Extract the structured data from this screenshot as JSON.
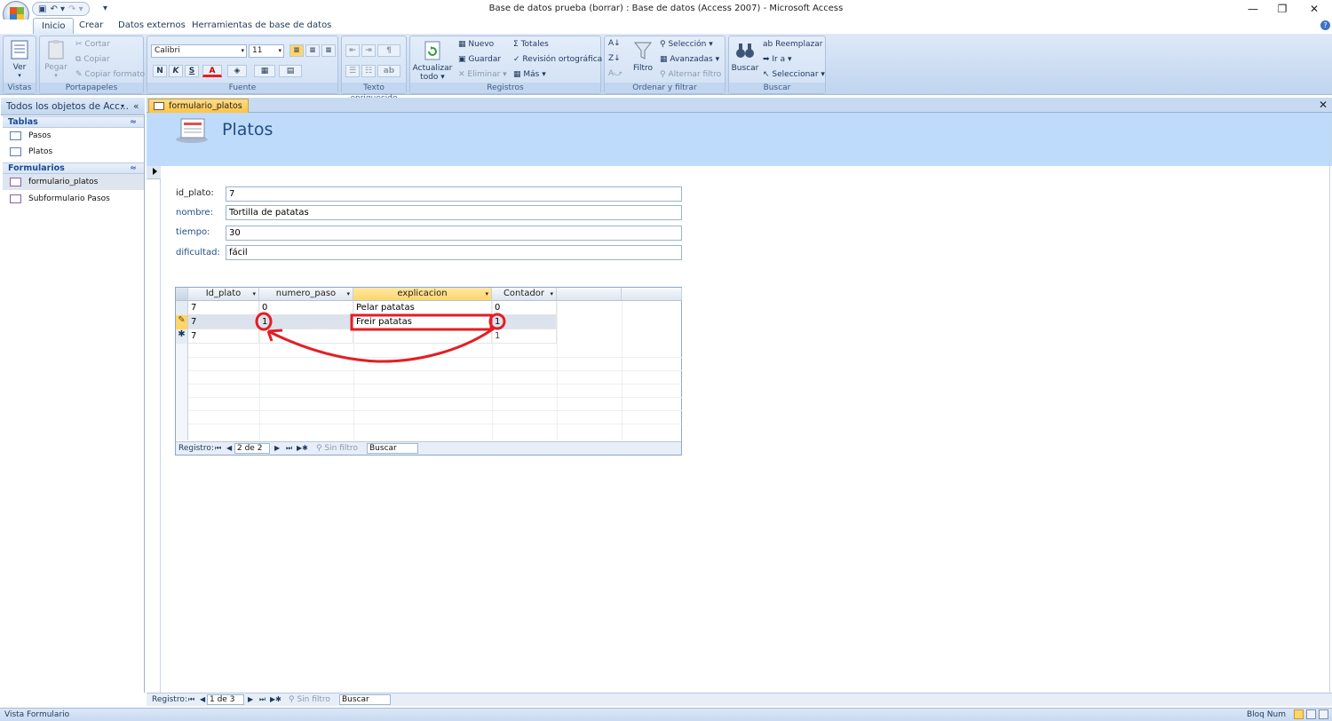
{
  "window": {
    "title": "Base de datos prueba (borrar) : Base de datos (Access 2007) - Microsoft Access",
    "controls": [
      "—",
      "❐",
      "✕"
    ]
  },
  "ribbon": {
    "tabs": [
      "Inicio",
      "Crear",
      "Datos externos",
      "Herramientas de base de datos"
    ],
    "active_tab": "Inicio",
    "groups": {
      "vistas": {
        "label": "Vistas",
        "ver": "Ver"
      },
      "portapapeles": {
        "label": "Portapapeles",
        "pegar": "Pegar",
        "cortar": "Cortar",
        "copiar": "Copiar",
        "copiar_formato": "Copiar formato"
      },
      "fuente": {
        "label": "Fuente",
        "font": "Calibri",
        "size": "11",
        "bold": "N",
        "italic": "K",
        "underline": "S"
      },
      "texto": {
        "label": "Texto enriquecido"
      },
      "registros": {
        "label": "Registros",
        "actualizar": "Actualizar",
        "todo": "todo",
        "nuevo": "Nuevo",
        "guardar": "Guardar",
        "eliminar": "Eliminar",
        "totales": "Totales",
        "revision": "Revisión ortográfica",
        "mas": "Más"
      },
      "ordenar": {
        "label": "Ordenar y filtrar",
        "filtro": "Filtro",
        "seleccion": "Selección",
        "avanzadas": "Avanzadas",
        "alternar": "Alternar filtro"
      },
      "buscar": {
        "label": "Buscar",
        "buscar": "Buscar",
        "reemplazar": "Reemplazar",
        "ira": "Ir a",
        "seleccionar": "Seleccionar"
      }
    }
  },
  "nav": {
    "header": "Todos los objetos de Acc...",
    "sections": [
      {
        "title": "Tablas",
        "items": [
          "Pasos",
          "Platos"
        ]
      },
      {
        "title": "Formularios",
        "items": [
          "formulario_platos",
          "Subformulario Pasos"
        ]
      }
    ]
  },
  "doc_tab": "formulario_platos",
  "form": {
    "title": "Platos",
    "fields": [
      {
        "label": "id_plato:",
        "value": "7"
      },
      {
        "label": "nombre:",
        "value": "Tortilla de patatas"
      },
      {
        "label": "tiempo:",
        "value": "30"
      },
      {
        "label": "dificultad:",
        "value": "fácil"
      }
    ]
  },
  "subform": {
    "columns": [
      "Id_plato",
      "numero_paso",
      "explicacion",
      "Contador"
    ],
    "rows": [
      {
        "selector": "",
        "cells": [
          "7",
          "0",
          "Pelar patatas",
          "0"
        ]
      },
      {
        "selector": "✎",
        "cells": [
          "7",
          "1",
          "Freir patatas",
          "1"
        ]
      },
      {
        "selector": "✱",
        "cells": [
          "7",
          "",
          "",
          "1"
        ]
      }
    ],
    "record_nav": {
      "label": "Registro:",
      "position": "2 de 2",
      "filter": "Sin filtro",
      "search": "Buscar"
    }
  },
  "main_record_nav": {
    "label": "Registro:",
    "position": "1 de 3",
    "filter": "Sin filtro",
    "search": "Buscar"
  },
  "status": {
    "left": "Vista Formulario",
    "right": "Bloq Num"
  },
  "colors": {
    "ribbon": "#c8daf2",
    "form_header": "#bfdbfb",
    "annotation": "#e31e24",
    "active_tab": "#ffc445"
  }
}
